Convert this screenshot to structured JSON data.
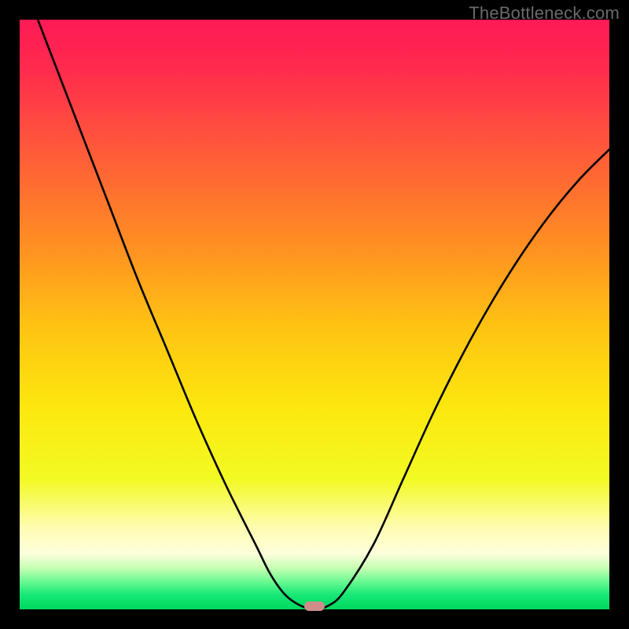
{
  "watermark": "TheBottleneck.com",
  "chart_data": {
    "type": "line",
    "title": "",
    "xlabel": "",
    "ylabel": "",
    "xlim": [
      0,
      100
    ],
    "ylim": [
      0,
      100
    ],
    "grid": false,
    "legend": false,
    "series": [
      {
        "name": "bottleneck-curve",
        "x": [
          0,
          5,
          10,
          15,
          20,
          25,
          30,
          35,
          40,
          42.5,
          45,
          47.5,
          50,
          52.5,
          55,
          60,
          65,
          70,
          75,
          80,
          85,
          90,
          95,
          100
        ],
        "y": [
          108,
          95,
          82,
          69,
          56,
          44,
          32,
          21,
          11,
          6,
          2.5,
          0.7,
          0,
          0.7,
          3,
          11,
          22,
          33,
          43,
          52,
          60,
          67,
          73,
          78
        ]
      }
    ],
    "annotations": [
      {
        "name": "optimal-marker",
        "x": 50,
        "y": 0.5,
        "shape": "pill",
        "color": "#cf8d8a"
      }
    ],
    "background_gradient": {
      "stops": [
        {
          "offset": 0.0,
          "color": "#ff1a55"
        },
        {
          "offset": 0.08,
          "color": "#ff2a4e"
        },
        {
          "offset": 0.22,
          "color": "#ff593a"
        },
        {
          "offset": 0.38,
          "color": "#ff8e22"
        },
        {
          "offset": 0.52,
          "color": "#ffc313"
        },
        {
          "offset": 0.66,
          "color": "#fce80e"
        },
        {
          "offset": 0.78,
          "color": "#f2fa24"
        },
        {
          "offset": 0.86,
          "color": "#fffcb0"
        },
        {
          "offset": 0.905,
          "color": "#fdffdc"
        },
        {
          "offset": 0.93,
          "color": "#c6ffb4"
        },
        {
          "offset": 0.955,
          "color": "#62f88f"
        },
        {
          "offset": 0.975,
          "color": "#18e877"
        },
        {
          "offset": 1.0,
          "color": "#00d85f"
        }
      ]
    }
  }
}
